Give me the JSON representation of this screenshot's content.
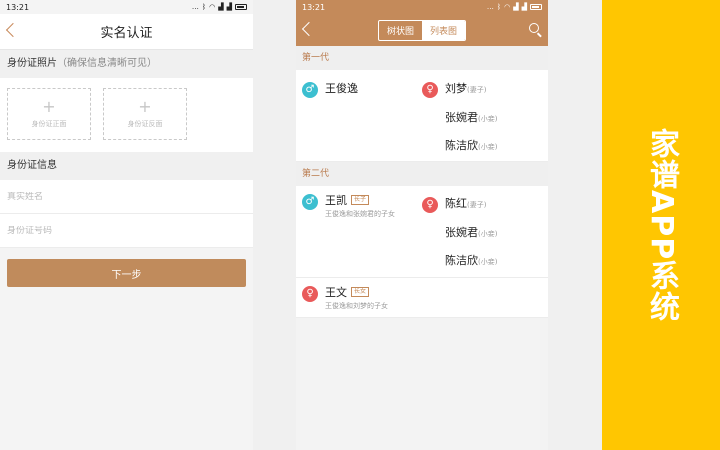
{
  "phone1": {
    "time": "13:21",
    "title": "实名认证",
    "photo_section": "身份证照片",
    "photo_hint": "（确保信息清晰可见）",
    "front_label": "身份证正面",
    "back_label": "身份证反面",
    "info_section": "身份证信息",
    "name_placeholder": "真实姓名",
    "id_placeholder": "身份证号码",
    "next_button": "下一步"
  },
  "phone2": {
    "time": "13:21",
    "tabs": [
      "树状图",
      "列表图"
    ],
    "active_tab": "列表图",
    "generations": [
      {
        "title": "第一代",
        "main": {
          "name": "王俊逸",
          "gender": "male"
        },
        "spouses": [
          {
            "name": "刘梦",
            "relation": "(妻子)"
          },
          {
            "name": "张婉君",
            "relation": "(小妾)"
          },
          {
            "name": "陈洁欣",
            "relation": "(小妾)"
          }
        ]
      },
      {
        "title": "第二代",
        "main": {
          "name": "王凯",
          "gender": "male",
          "tag": "长子",
          "sub": "王俊逸和张婉君的子女"
        },
        "spouses": [
          {
            "name": "陈红",
            "relation": "(妻子)"
          },
          {
            "name": "张婉君",
            "relation": "(小妾)"
          },
          {
            "name": "陈洁欣",
            "relation": "(小妾)"
          }
        ],
        "extra": {
          "name": "王文",
          "gender": "female",
          "tag": "长女",
          "sub": "王俊逸和刘梦的子女"
        }
      }
    ]
  },
  "banner": {
    "title": "家谱APP系统"
  },
  "colors": {
    "accent": "#c48a5a",
    "male": "#3cbfd0",
    "female": "#e95a5a",
    "banner": "#ffc601"
  },
  "icons": {
    "male": "male-symbol-icon",
    "female": "female-symbol-icon"
  }
}
